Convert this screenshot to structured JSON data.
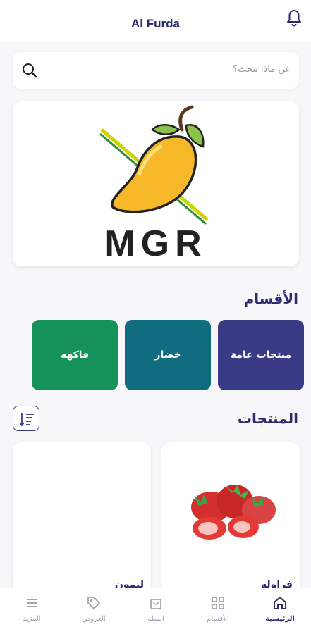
{
  "header": {
    "title": "Al Furda"
  },
  "search": {
    "placeholder": "عن ماذا تبحث؟"
  },
  "banner": {
    "brand": "MGR"
  },
  "categories": {
    "title": "الأقسام",
    "items": [
      {
        "label": "منتجات عامة",
        "color": "#3b3a86"
      },
      {
        "label": "خضار",
        "color": "#0f6d7f"
      },
      {
        "label": "فاكهه",
        "color": "#15925a"
      }
    ]
  },
  "products": {
    "title": "المنتجات",
    "items": [
      {
        "name": "فراولة"
      },
      {
        "name": "ليمون"
      }
    ]
  },
  "tabbar": {
    "items": [
      {
        "label": "الرئيسية",
        "icon": "home-icon",
        "active": true
      },
      {
        "label": "الأقسام",
        "icon": "grid-icon"
      },
      {
        "label": "السلة",
        "icon": "bag-icon"
      },
      {
        "label": "العروض",
        "icon": "tag-icon"
      },
      {
        "label": "المزيد",
        "icon": "menu-icon"
      }
    ]
  },
  "colors": {
    "primary": "#2b2a6b",
    "accent": "#3b3a86"
  }
}
